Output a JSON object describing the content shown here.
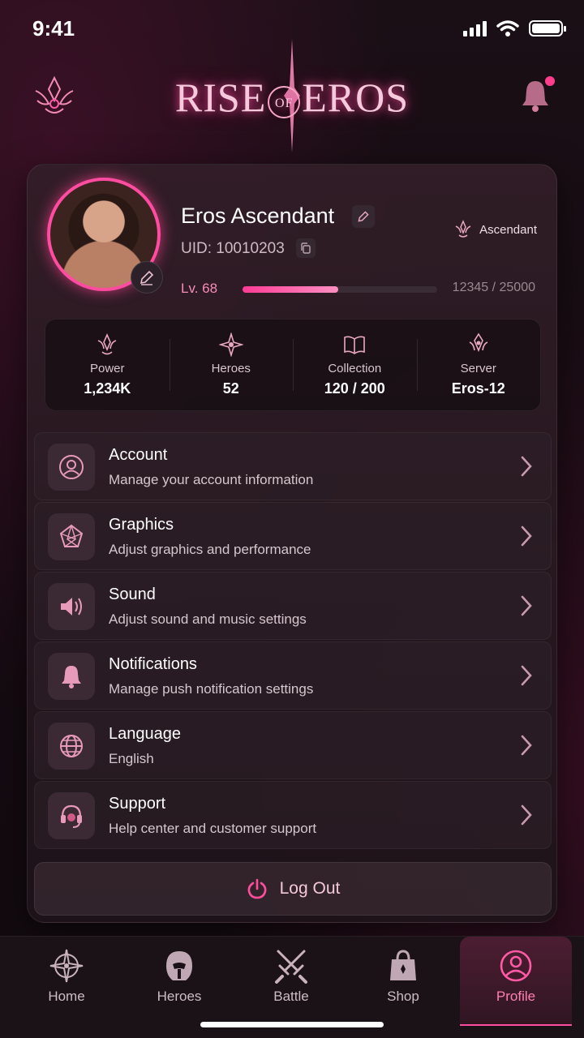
{
  "status": {
    "time": "9:41"
  },
  "header": {
    "logo_left": "RISE",
    "logo_mid": "OF",
    "logo_right": "EROS"
  },
  "profile": {
    "name": "Eros Ascendant",
    "uid": "UID: 10010203",
    "rank": "Ascendant",
    "level": "Lv. 68",
    "xp_text": "12345 / 25000",
    "xp_fraction": 0.49
  },
  "stats": [
    {
      "label": "Power",
      "value": "1,234K"
    },
    {
      "label": "Heroes",
      "value": "52"
    },
    {
      "label": "Collection",
      "value": "120 / 200"
    },
    {
      "label": "Server",
      "value": "Eros-12"
    }
  ],
  "menu": [
    {
      "title": "Account",
      "subtitle": "Manage your account information",
      "icon": "account-icon"
    },
    {
      "title": "Graphics",
      "subtitle": "Adjust graphics and performance",
      "icon": "graphics-icon"
    },
    {
      "title": "Sound",
      "subtitle": "Adjust sound and music settings",
      "icon": "sound-icon"
    },
    {
      "title": "Notifications",
      "subtitle": "Manage push notification settings",
      "icon": "bell-icon"
    },
    {
      "title": "Language",
      "subtitle": "English",
      "icon": "globe-icon"
    },
    {
      "title": "Support",
      "subtitle": "Help center and customer support",
      "icon": "headset-icon"
    }
  ],
  "logout_label": "Log Out",
  "tabs": [
    {
      "label": "Home"
    },
    {
      "label": "Heroes"
    },
    {
      "label": "Battle"
    },
    {
      "label": "Shop"
    },
    {
      "label": "Profile"
    }
  ],
  "colors": {
    "accent": "#ff4ba0",
    "background": "#140b11",
    "card": "#2a1c24"
  }
}
